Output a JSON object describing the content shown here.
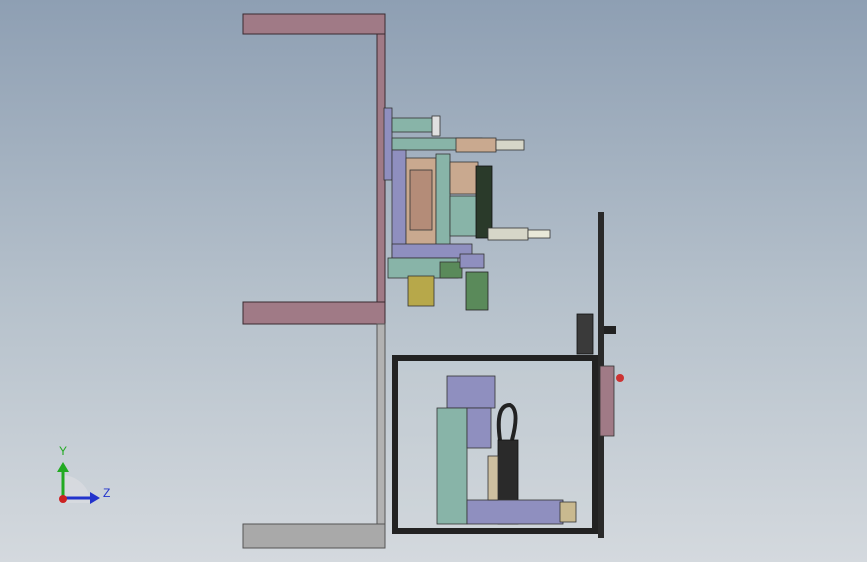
{
  "viewport": {
    "background_top": "#8e9fb3",
    "background_bottom": "#d4d9de"
  },
  "triad": {
    "y_label": "Y",
    "z_label": "Z",
    "y_color": "#22aa22",
    "z_color": "#2233cc",
    "x_color": "#cc2222"
  },
  "colors": {
    "frame_pink": "#a07a86",
    "frame_grey": "#a9a9a9",
    "machine_purple": "#8f8fbf",
    "machine_tan": "#c9a98f",
    "machine_teal": "#88b4a8",
    "machine_green": "#5a8a5a",
    "machine_dark": "#2a2a2a"
  }
}
